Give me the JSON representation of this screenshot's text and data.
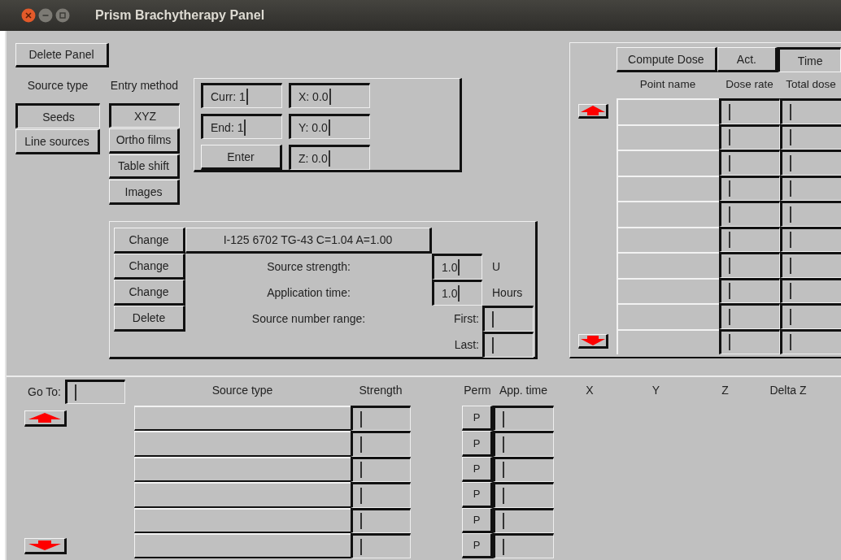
{
  "window": {
    "title": "Prism Brachytherapy Panel"
  },
  "delete_button": "Delete Panel",
  "source_type": {
    "label": "Source type",
    "options": [
      {
        "label": "Seeds",
        "selected": true
      },
      {
        "label": "Line sources",
        "selected": false
      }
    ]
  },
  "entry_method": {
    "label": "Entry method",
    "options": [
      {
        "label": "XYZ",
        "selected": true
      },
      {
        "label": "Ortho films",
        "selected": false
      },
      {
        "label": "Table shift",
        "selected": false
      },
      {
        "label": "Images",
        "selected": false
      }
    ]
  },
  "coordinates": {
    "curr": "Curr: 1",
    "x": "X: 0.0",
    "end": "End: 1",
    "y": "Y: 0.0",
    "enter_button": "Enter",
    "z": "Z: 0.0"
  },
  "source": {
    "change_buttons": [
      "Change",
      "Change",
      "Change"
    ],
    "delete_button": "Delete",
    "name": "I-125 6702 TG-43 C=1.04 A=1.00",
    "strength": {
      "label": "Source strength:",
      "value": "1.0",
      "unit": "U"
    },
    "app_time": {
      "label": "Application time:",
      "value": "1.0",
      "unit": "Hours"
    },
    "range": {
      "label": "Source number range:",
      "first": "First:",
      "last": "Last:"
    }
  },
  "dose": {
    "buttons": [
      {
        "label": "Compute Dose",
        "selected": false
      },
      {
        "label": "Act.",
        "selected": false
      },
      {
        "label": "Time",
        "selected": true
      }
    ],
    "columns": [
      "Point name",
      "Dose rate",
      "Total dose"
    ]
  },
  "sources_table": {
    "goto_label": "Go To:",
    "columns": [
      "Source type",
      "Strength",
      "Perm",
      "App. time",
      "X",
      "Y",
      "Z",
      "Delta Z"
    ],
    "perm_buttons": [
      "P",
      "P",
      "P",
      "P",
      "P",
      "P"
    ]
  }
}
